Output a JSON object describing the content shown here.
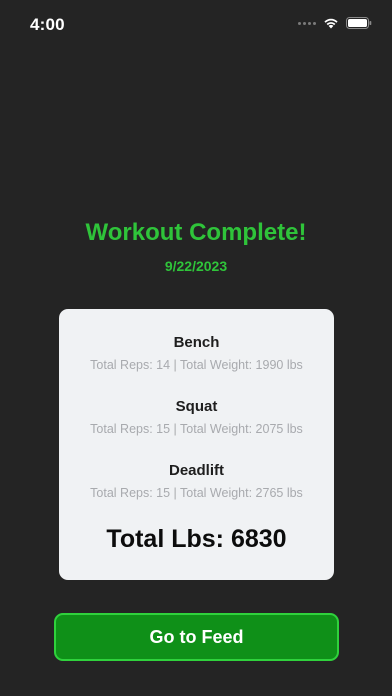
{
  "status_bar": {
    "time": "4:00",
    "icons": [
      "signal-dots-icon",
      "wifi-icon",
      "battery-icon"
    ]
  },
  "header": {
    "title": "Workout Complete!",
    "date": "9/22/2023"
  },
  "summary": {
    "exercises": [
      {
        "name": "Bench",
        "stats": "Total Reps: 14 | Total Weight: 1990 lbs"
      },
      {
        "name": "Squat",
        "stats": "Total Reps: 15 | Total Weight: 2075 lbs"
      },
      {
        "name": "Deadlift",
        "stats": "Total Reps: 15 | Total Weight: 2765 lbs"
      }
    ],
    "total_label": "Total Lbs: 6830"
  },
  "actions": {
    "feed_button_label": "Go to Feed"
  },
  "colors": {
    "background": "#242424",
    "accent_green": "#2fc43a",
    "button_fill": "#0f9018",
    "card": "#f0f2f4"
  }
}
